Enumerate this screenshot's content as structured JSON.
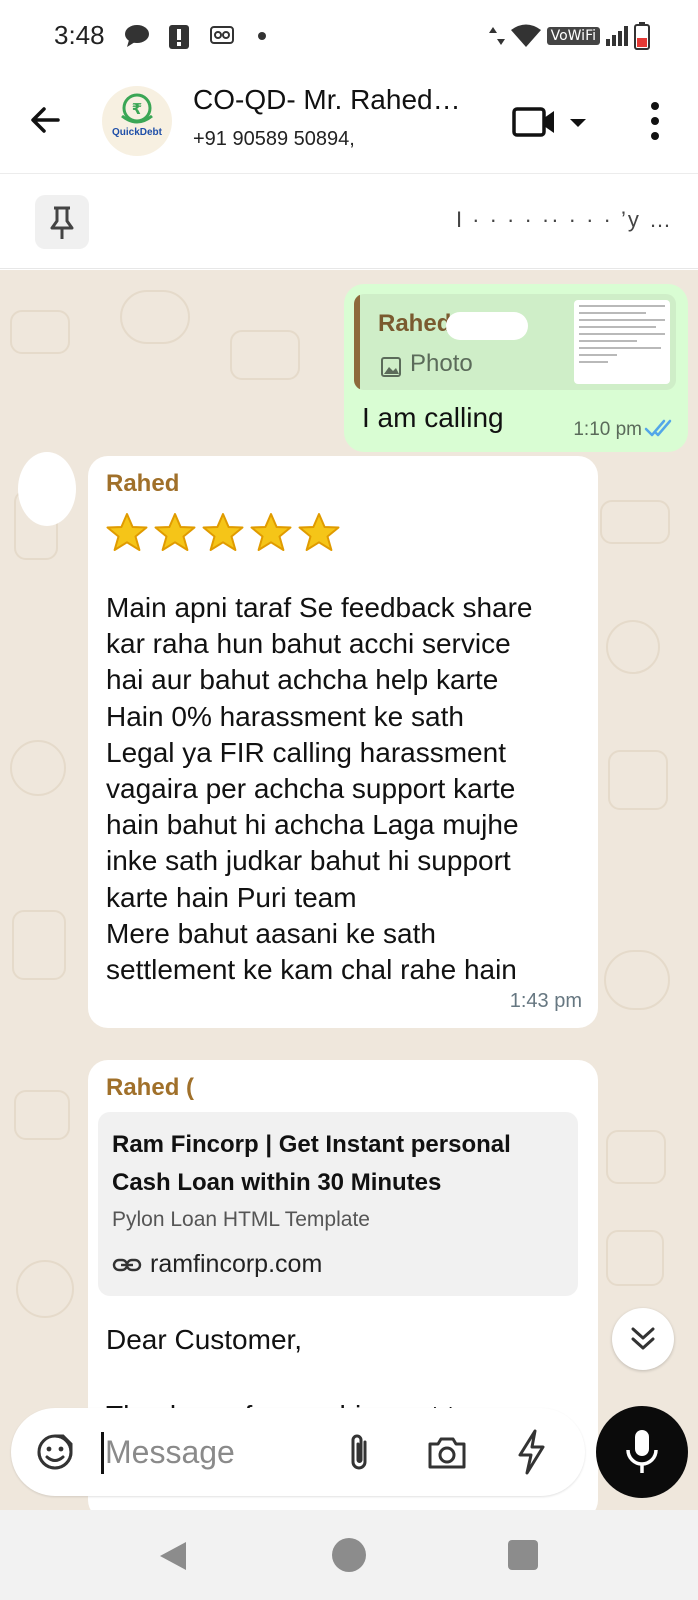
{
  "status_bar": {
    "time": "3:48",
    "network_label": "VoWiFi"
  },
  "header": {
    "title": "CO-QD- Mr. Rahed…",
    "subtitle": "+91 90589 50894,",
    "avatar_text": "QuickDebt"
  },
  "pinned": {
    "text": "I          ·          ·        ·        ·        ··        ·      · ·   ’y …"
  },
  "messages": {
    "outgoing": {
      "reply_name": "Rahed",
      "reply_photo_label": "Photo",
      "text": "I am calling",
      "time": "1:10 pm"
    },
    "incoming_1": {
      "sender": "Rahed",
      "stars": 5,
      "body": "Main apni taraf Se feedback share\nkar raha hun bahut acchi service\nhai aur bahut achcha help karte\nHain 0% harassment ke sath\nLegal ya FIR calling harassment\nvagaira per achcha support karte\nhain bahut hi achcha Laga mujhe\ninke sath judkar bahut hi support\nkarte hain Puri team\nMere bahut aasani ke sath\nsettlement ke kam chal rahe hain",
      "time": "1:43 pm"
    },
    "incoming_2": {
      "sender": "Rahed (",
      "link_title": "Ram Fincorp | Get Instant personal Cash Loan within 30 Minutes",
      "link_subtitle": "Pylon Loan HTML Template",
      "link_url": "ramfincorp.com",
      "greeting": "Dear Customer,",
      "cut_text": "Thank you for reaching out to us"
    }
  },
  "input": {
    "placeholder": "Message"
  },
  "colors": {
    "outgoing_bubble": "#d9fdd3",
    "incoming_bubble": "#ffffff",
    "chat_background": "#efe7dc",
    "sender_name": "#a0702a",
    "read_ticks": "#53a6e8"
  }
}
